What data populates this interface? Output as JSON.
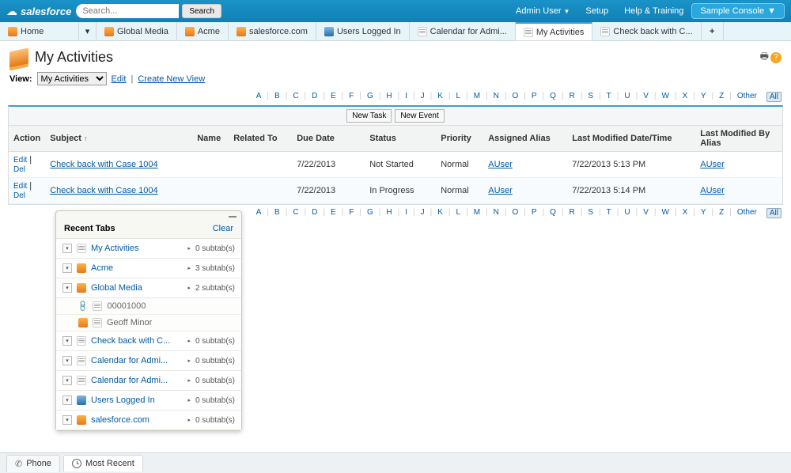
{
  "header": {
    "brand": "salesforce",
    "search_placeholder": "Search...",
    "search_button": "Search",
    "links": {
      "admin": "Admin User",
      "setup": "Setup",
      "help": "Help & Training"
    },
    "app_menu": "Sample Console"
  },
  "tabs": {
    "home": "Home",
    "items": [
      {
        "label": "Global Media"
      },
      {
        "label": "Acme"
      },
      {
        "label": "salesforce.com"
      },
      {
        "label": "Users Logged In"
      },
      {
        "label": "Calendar for Admi..."
      },
      {
        "label": "My Activities",
        "active": true
      },
      {
        "label": "Check back with C..."
      }
    ]
  },
  "page": {
    "title": "My Activities"
  },
  "view": {
    "label": "View:",
    "selected": "My Activities",
    "edit": "Edit",
    "create": "Create New View"
  },
  "alpha": {
    "letters": [
      "A",
      "B",
      "C",
      "D",
      "E",
      "F",
      "G",
      "H",
      "I",
      "J",
      "K",
      "L",
      "M",
      "N",
      "O",
      "P",
      "Q",
      "R",
      "S",
      "T",
      "U",
      "V",
      "W",
      "X",
      "Y",
      "Z"
    ],
    "other": "Other",
    "all": "All"
  },
  "buttons": {
    "new_task": "New Task",
    "new_event": "New Event"
  },
  "columns": {
    "action": "Action",
    "subject": "Subject",
    "name": "Name",
    "related": "Related To",
    "due": "Due Date",
    "status": "Status",
    "priority": "Priority",
    "alias": "Assigned Alias",
    "modified": "Last Modified Date/Time",
    "modified_by": "Last Modified By Alias"
  },
  "actions": {
    "edit": "Edit",
    "del": "Del"
  },
  "rows": [
    {
      "subject": "Check back with Case 1004",
      "name": "",
      "related": "",
      "due": "7/22/2013",
      "status": "Not Started",
      "priority": "Normal",
      "alias": "AUser",
      "modified": "7/22/2013 5:13 PM",
      "modified_by": "AUser"
    },
    {
      "subject": "Check back with Case 1004",
      "name": "",
      "related": "",
      "due": "7/22/2013",
      "status": "In Progress",
      "priority": "Normal",
      "alias": "AUser",
      "modified": "7/22/2013 5:14 PM",
      "modified_by": "AUser"
    }
  ],
  "recent": {
    "title": "Recent Tabs",
    "clear": "Clear",
    "items": [
      {
        "label": "My Activities",
        "subtabs": "0 subtab(s)",
        "icon": "note"
      },
      {
        "label": "Acme",
        "subtabs": "3 subtab(s)",
        "icon": "orange"
      },
      {
        "label": "Global Media",
        "subtabs": "2 subtab(s)",
        "icon": "orange",
        "expanded": true,
        "children": [
          {
            "label": "00001000",
            "icon": "link"
          },
          {
            "label": "Geoff Minor",
            "icon": "person"
          }
        ]
      },
      {
        "label": "Check back with C...",
        "subtabs": "0 subtab(s)",
        "icon": "note"
      },
      {
        "label": "Calendar for Admi...",
        "subtabs": "0 subtab(s)",
        "icon": "note"
      },
      {
        "label": "Calendar for Admi...",
        "subtabs": "0 subtab(s)",
        "icon": "calendar"
      },
      {
        "label": "Users Logged In",
        "subtabs": "0 subtab(s)",
        "icon": "blue"
      },
      {
        "label": "salesforce.com",
        "subtabs": "0 subtab(s)",
        "icon": "orange"
      }
    ]
  },
  "footer": {
    "phone": "Phone",
    "most_recent": "Most Recent"
  }
}
